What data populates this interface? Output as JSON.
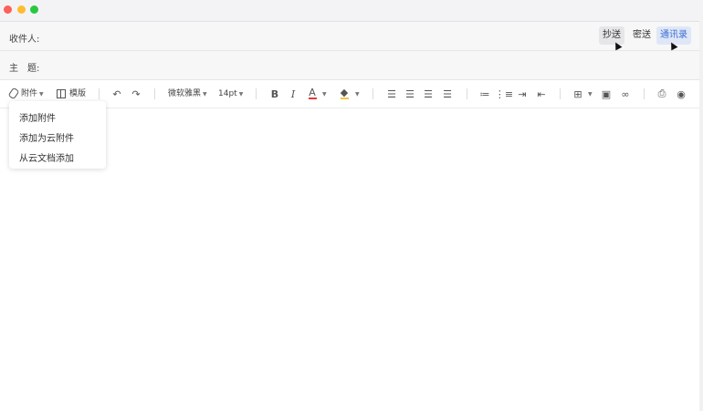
{
  "window": {
    "buttons": [
      "close",
      "minimize",
      "maximize"
    ]
  },
  "to_row": {
    "label": "收件人:",
    "value": "",
    "cc_label": "抄送",
    "bcc_label": "密送",
    "contacts_label": "通讯录"
  },
  "subject_row": {
    "label": "主　题:",
    "value": ""
  },
  "toolbar": {
    "attachment_label": "附件",
    "template_label": "模版",
    "font_family": "微软雅黑",
    "font_size": "14pt",
    "icons": [
      "paperclip-icon",
      "template-icon",
      "undo-icon",
      "redo-icon",
      "bold-icon",
      "italic-icon",
      "font-color-icon",
      "highlight-icon",
      "align-left-icon",
      "align-center-icon",
      "align-right-icon",
      "justify-icon",
      "bullet-list-icon",
      "numbered-list-icon",
      "indent-icon",
      "outdent-icon",
      "table-icon",
      "image-icon",
      "link-icon",
      "print-icon",
      "preview-icon"
    ]
  },
  "attachment_menu": {
    "items": [
      "添加附件",
      "添加为云附件",
      "从云文档添加"
    ]
  },
  "colors": {
    "accent": "#3b6fd6",
    "font_color_underline": "#e23b3b",
    "highlight_color": "#f4c542"
  }
}
